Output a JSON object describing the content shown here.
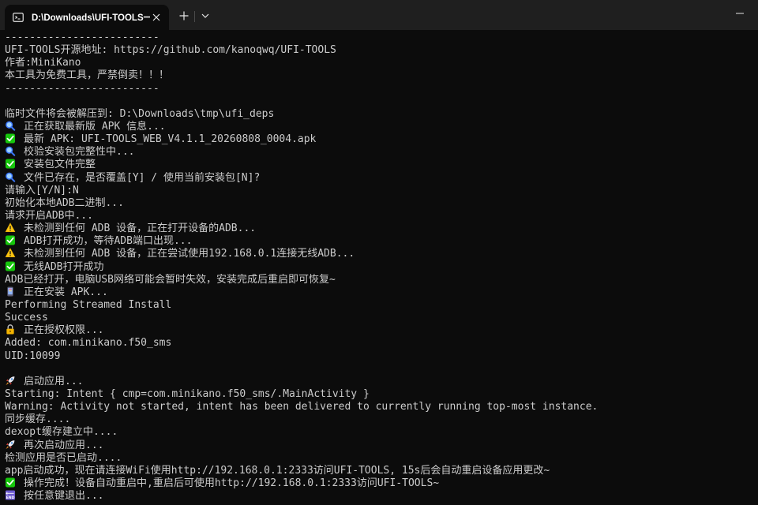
{
  "window": {
    "tab_title": "D:\\Downloads\\UFI-TOOLS一键",
    "new_tab_symbol": "+",
    "accent_colors": {
      "background": "#0c0c0c",
      "titlebar": "#1f1f1f",
      "text": "#cccccc",
      "check_green": "#16c60c",
      "warn_yellow": "#f9c513",
      "search_blue": "#3b78ff"
    }
  },
  "terminal": {
    "lines": [
      {
        "icon": "",
        "text": "-------------------------"
      },
      {
        "icon": "",
        "text": "UFI-TOOLS开源地址: https://github.com/kanoqwq/UFI-TOOLS"
      },
      {
        "icon": "",
        "text": "作者:MiniKano"
      },
      {
        "icon": "",
        "text": "本工具为免费工具，严禁倒卖！！！"
      },
      {
        "icon": "",
        "text": "-------------------------"
      },
      {
        "icon": "",
        "text": ""
      },
      {
        "icon": "",
        "text": "临时文件将会被解压到: D:\\Downloads\\tmp\\ufi_deps"
      },
      {
        "icon": "search",
        "text": "正在获取最新版 APK 信息..."
      },
      {
        "icon": "check",
        "text": "最新 APK: UFI-TOOLS_WEB_V4.1.1_20260808_0004.apk"
      },
      {
        "icon": "search",
        "text": "校验安装包完整性中..."
      },
      {
        "icon": "check",
        "text": "安装包文件完整"
      },
      {
        "icon": "search",
        "text": "文件已存在，是否覆盖[Y] / 使用当前安装包[N]?"
      },
      {
        "icon": "",
        "text": "请输入[Y/N]:N"
      },
      {
        "icon": "",
        "text": "初始化本地ADB二进制..."
      },
      {
        "icon": "",
        "text": "请求开启ADB中..."
      },
      {
        "icon": "warning",
        "text": "未检测到任何 ADB 设备，正在打开设备的ADB..."
      },
      {
        "icon": "check",
        "text": "ADB打开成功，等待ADB端口出现..."
      },
      {
        "icon": "warning",
        "text": "未检测到任何 ADB 设备，正在尝试使用192.168.0.1连接无线ADB..."
      },
      {
        "icon": "check",
        "text": "无线ADB打开成功"
      },
      {
        "icon": "",
        "text": "ADB已经打开，电脑USB网络可能会暂时失效，安装完成后重启即可恢复~"
      },
      {
        "icon": "phone",
        "text": "正在安装 APK..."
      },
      {
        "icon": "",
        "text": "Performing Streamed Install"
      },
      {
        "icon": "",
        "text": "Success"
      },
      {
        "icon": "lock",
        "text": "正在授权权限..."
      },
      {
        "icon": "",
        "text": "Added: com.minikano.f50_sms"
      },
      {
        "icon": "",
        "text": "UID:10099"
      },
      {
        "icon": "",
        "text": ""
      },
      {
        "icon": "rocket",
        "text": "启动应用..."
      },
      {
        "icon": "",
        "text": "Starting: Intent { cmp=com.minikano.f50_sms/.MainActivity }"
      },
      {
        "icon": "",
        "text": "Warning: Activity not started, intent has been delivered to currently running top-most instance."
      },
      {
        "icon": "",
        "text": "同步缓存...."
      },
      {
        "icon": "",
        "text": "dexopt缓存建立中...."
      },
      {
        "icon": "rocket",
        "text": "再次启动应用..."
      },
      {
        "icon": "",
        "text": "检测应用是否已启动...."
      },
      {
        "icon": "",
        "text": "app启动成功，现在请连接WiFi使用http://192.168.0.1:2333访问UFI-TOOLS, 15s后会自动重启设备应用更改~"
      },
      {
        "icon": "check",
        "text": "操作完成！设备自动重启中,重启后可使用http://192.168.0.1:2333访问UFI-TOOLS~"
      },
      {
        "icon": "end",
        "text": "按任意键退出..."
      }
    ]
  }
}
